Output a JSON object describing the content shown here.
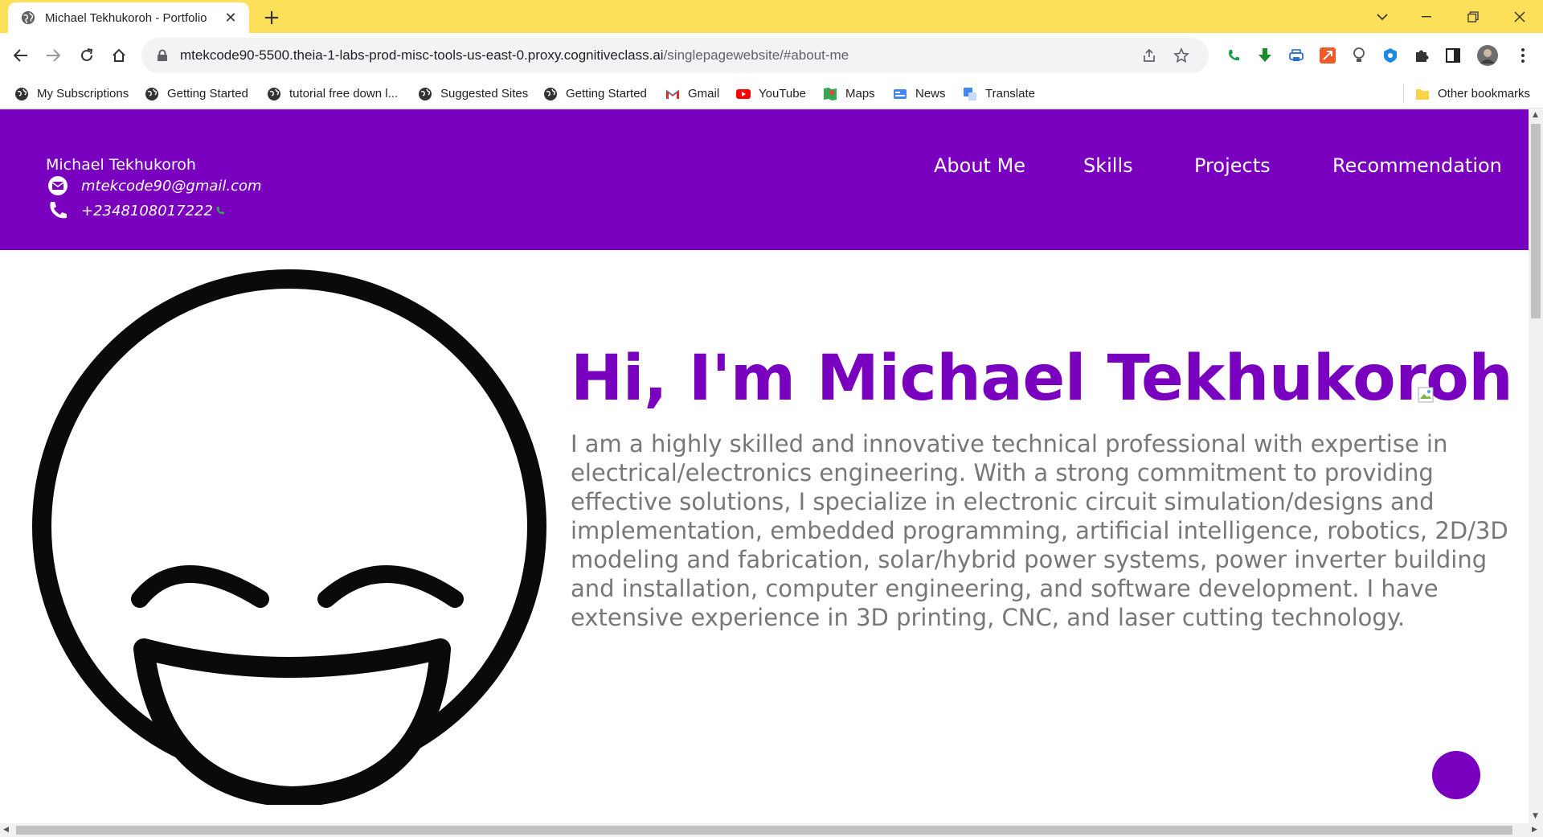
{
  "browser": {
    "tab_title": "Michael Tekhukoroh - Portfolio",
    "tab_close": "✕",
    "new_tab": "+",
    "url_host": "mtekcode90-5500.theia-1-labs-prod-misc-tools-us-east-0.proxy.cognitiveclass.ai",
    "url_path": "/singlepagewebsite/#about-me",
    "bookmarks": [
      {
        "label": "My Subscriptions"
      },
      {
        "label": "Getting Started"
      },
      {
        "label": "tutorial free down l..."
      },
      {
        "label": "Suggested Sites"
      },
      {
        "label": "Getting Started"
      },
      {
        "label": "Gmail"
      },
      {
        "label": "YouTube"
      },
      {
        "label": "Maps"
      },
      {
        "label": "News"
      },
      {
        "label": "Translate"
      }
    ],
    "other_bookmarks": "Other bookmarks"
  },
  "site": {
    "contact": {
      "name": "Michael Tekhukoroh",
      "email": "mtekcode90@gmail.com",
      "phone": "+2348108017222"
    },
    "nav": [
      "About Me",
      "Skills",
      "Projects",
      "Recommendation"
    ],
    "headline": "Hi, I'm Michael Tekhukoroh",
    "bio": "I am a highly skilled and innovative technical professional with expertise in electrical/electronics engineering. With a strong commitment to providing effective solutions, I specialize in electronic circuit simulation/designs and implementation, embedded programming, artificial intelligence, robotics, 2D/3D modeling and fabrication, solar/hybrid power systems, power inverter building and installation, computer engineering, and software development. I have extensive experience in 3D printing, CNC, and laser cutting technology."
  },
  "colors": {
    "brand_purple": "#7a00c0",
    "chrome_titlebar": "#fde05a",
    "bio_text": "#777777"
  }
}
